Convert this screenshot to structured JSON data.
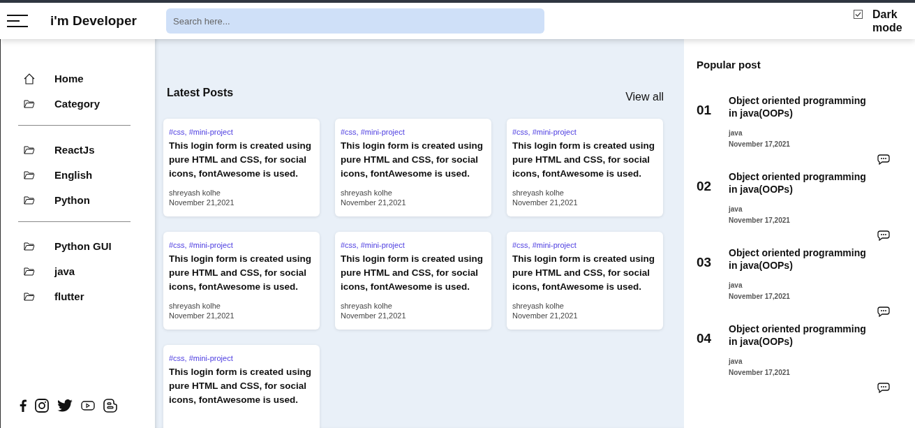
{
  "header": {
    "title": "i'm Developer",
    "search": {
      "placeholder": "Search here..."
    },
    "dark_mode": {
      "label": "Dark mode",
      "checked": true
    }
  },
  "sidebar": {
    "groups": [
      [
        {
          "label": "Home",
          "kind": "home"
        },
        {
          "label": "Category",
          "kind": "folder"
        }
      ],
      [
        {
          "label": "ReactJs",
          "kind": "folder"
        },
        {
          "label": "English",
          "kind": "folder"
        },
        {
          "label": "Python",
          "kind": "folder"
        }
      ],
      [
        {
          "label": "Python GUI",
          "kind": "folder"
        },
        {
          "label": "java",
          "kind": "folder"
        },
        {
          "label": "flutter",
          "kind": "folder"
        }
      ]
    ],
    "social": [
      {
        "kind": "facebook"
      },
      {
        "kind": "instagram"
      },
      {
        "kind": "twitter"
      },
      {
        "kind": "youtube"
      },
      {
        "kind": "blogger"
      }
    ]
  },
  "latest": {
    "title": "Latest Posts",
    "view_all": "View all",
    "posts": [
      {
        "tags": "#css, #mini-project",
        "title": "This login form is created using pure HTML and CSS, for social icons, fontAwesome is used.",
        "author": "shreyash kolhe",
        "date": "November 21,2021"
      },
      {
        "tags": "#css, #mini-project",
        "title": "This login form is created using pure HTML and CSS, for social icons, fontAwesome is used.",
        "author": "shreyash kolhe",
        "date": "November 21,2021"
      },
      {
        "tags": "#css, #mini-project",
        "title": "This login form is created using pure HTML and CSS, for social icons, fontAwesome is used.",
        "author": "shreyash kolhe",
        "date": "November 21,2021"
      },
      {
        "tags": "#css, #mini-project",
        "title": "This login form is created using pure HTML and CSS, for social icons, fontAwesome is used.",
        "author": "shreyash kolhe",
        "date": "November 21,2021"
      },
      {
        "tags": "#css, #mini-project",
        "title": "This login form is created using pure HTML and CSS, for social icons, fontAwesome is used.",
        "author": "shreyash kolhe",
        "date": "November 21,2021"
      },
      {
        "tags": "#css, #mini-project",
        "title": "This login form is created using pure HTML and CSS, for social icons, fontAwesome is used.",
        "author": "shreyash kolhe",
        "date": "November 21,2021"
      },
      {
        "tags": "#css, #mini-project",
        "title": "This login form is created using pure HTML and CSS, for social icons, fontAwesome is used."
      }
    ]
  },
  "popular": {
    "title": "Popular post",
    "posts": [
      {
        "number": "01",
        "title": "Object oriented programming in java(OOPs)",
        "category": "java",
        "date": "November 17,2021"
      },
      {
        "number": "02",
        "title": "Object oriented programming in java(OOPs)",
        "category": "java",
        "date": "November 17,2021"
      },
      {
        "number": "03",
        "title": "Object oriented programming in java(OOPs)",
        "category": "java",
        "date": "November 17,2021"
      },
      {
        "number": "04",
        "title": "Object oriented programming in java(OOPs)",
        "category": "java",
        "date": "November 17,2021"
      }
    ]
  }
}
